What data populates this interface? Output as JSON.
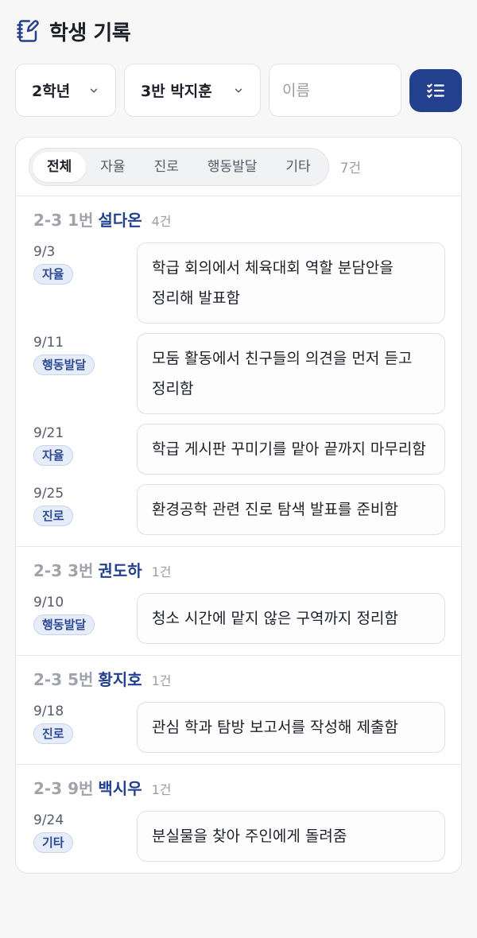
{
  "header": {
    "title": "학생 기록",
    "icon": "notebook-pen-icon"
  },
  "filters": {
    "grade": "2학년",
    "student": "3반 박지훈",
    "name_placeholder": "이름",
    "list_icon": "checklist-icon"
  },
  "tabs": [
    {
      "label": "전체",
      "active": true
    },
    {
      "label": "자율",
      "active": false
    },
    {
      "label": "진로",
      "active": false
    },
    {
      "label": "행동발달",
      "active": false
    },
    {
      "label": "기타",
      "active": false
    }
  ],
  "total_count": "7건",
  "groups": [
    {
      "number": "2-3 1번",
      "name": "설다온",
      "count": "4건",
      "records": [
        {
          "date": "9/3",
          "tag": "자율",
          "text": "학급 회의에서 체육대회 역할 분담안을 정리해 발표함"
        },
        {
          "date": "9/11",
          "tag": "행동발달",
          "text": "모둠 활동에서 친구들의 의견을 먼저 듣고 정리함"
        },
        {
          "date": "9/21",
          "tag": "자율",
          "text": "학급 게시판 꾸미기를 맡아 끝까지 마무리함"
        },
        {
          "date": "9/25",
          "tag": "진로",
          "text": "환경공학 관련 진로 탐색 발표를 준비함"
        }
      ]
    },
    {
      "number": "2-3 3번",
      "name": "권도하",
      "count": "1건",
      "records": [
        {
          "date": "9/10",
          "tag": "행동발달",
          "text": "청소 시간에 맡지 않은 구역까지 정리함"
        }
      ]
    },
    {
      "number": "2-3 5번",
      "name": "황지호",
      "count": "1건",
      "records": [
        {
          "date": "9/18",
          "tag": "진로",
          "text": "관심 학과 탐방 보고서를 작성해 제출함"
        }
      ]
    },
    {
      "number": "2-3 9번",
      "name": "백시우",
      "count": "1건",
      "records": [
        {
          "date": "9/24",
          "tag": "기타",
          "text": "분실물을 찾아 주인에게 돌려줌"
        }
      ]
    }
  ],
  "colors": {
    "accent": "#23408e",
    "badge_bg": "#e6ecf8",
    "page_bg": "#f7f7f8"
  }
}
